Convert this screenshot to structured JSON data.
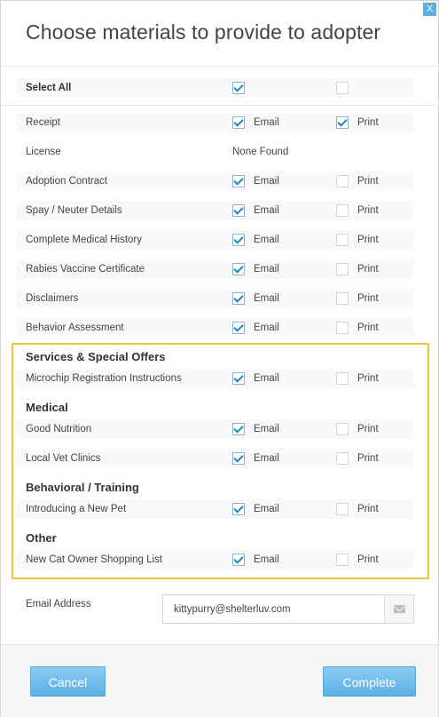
{
  "dialog": {
    "title": "Choose materials to provide to adopter",
    "close_label": "X"
  },
  "options": {
    "email": "Email",
    "print": "Print"
  },
  "select_all": {
    "label": "Select All",
    "email_checked": true,
    "print_checked": false
  },
  "materials": [
    {
      "label": "Receipt",
      "email": true,
      "print": true
    },
    {
      "label": "License",
      "none_found": "None Found"
    },
    {
      "label": "Adoption Contract",
      "email": true,
      "print": false
    },
    {
      "label": "Spay / Neuter Details",
      "email": true,
      "print": false
    },
    {
      "label": "Complete Medical History",
      "email": true,
      "print": false
    },
    {
      "label": "Rabies Vaccine Certificate",
      "email": true,
      "print": false
    },
    {
      "label": "Disclaimers",
      "email": true,
      "print": false
    },
    {
      "label": "Behavior Assessment",
      "email": true,
      "print": false
    }
  ],
  "sections": [
    {
      "heading": "Services & Special Offers",
      "items": [
        {
          "label": "Microchip Registration Instructions",
          "email": true,
          "print": false
        }
      ]
    },
    {
      "heading": "Medical",
      "items": [
        {
          "label": "Good Nutrition",
          "email": true,
          "print": false
        },
        {
          "label": "Local Vet Clinics",
          "email": true,
          "print": false
        }
      ]
    },
    {
      "heading": "Behavioral / Training",
      "items": [
        {
          "label": "Introducing a New Pet",
          "email": true,
          "print": false
        }
      ]
    },
    {
      "heading": "Other",
      "items": [
        {
          "label": "New Cat Owner Shopping List",
          "email": true,
          "print": false
        }
      ]
    }
  ],
  "email_address": {
    "label": "Email Address",
    "value": "kittypurry@shelterluv.com",
    "icon": "envelope-icon"
  },
  "footer": {
    "cancel_label": "Cancel",
    "complete_label": "Complete"
  },
  "colors": {
    "accent": "#5ab0e6",
    "checkmark": "#1f85c4",
    "highlight_border": "#f0c33c"
  }
}
